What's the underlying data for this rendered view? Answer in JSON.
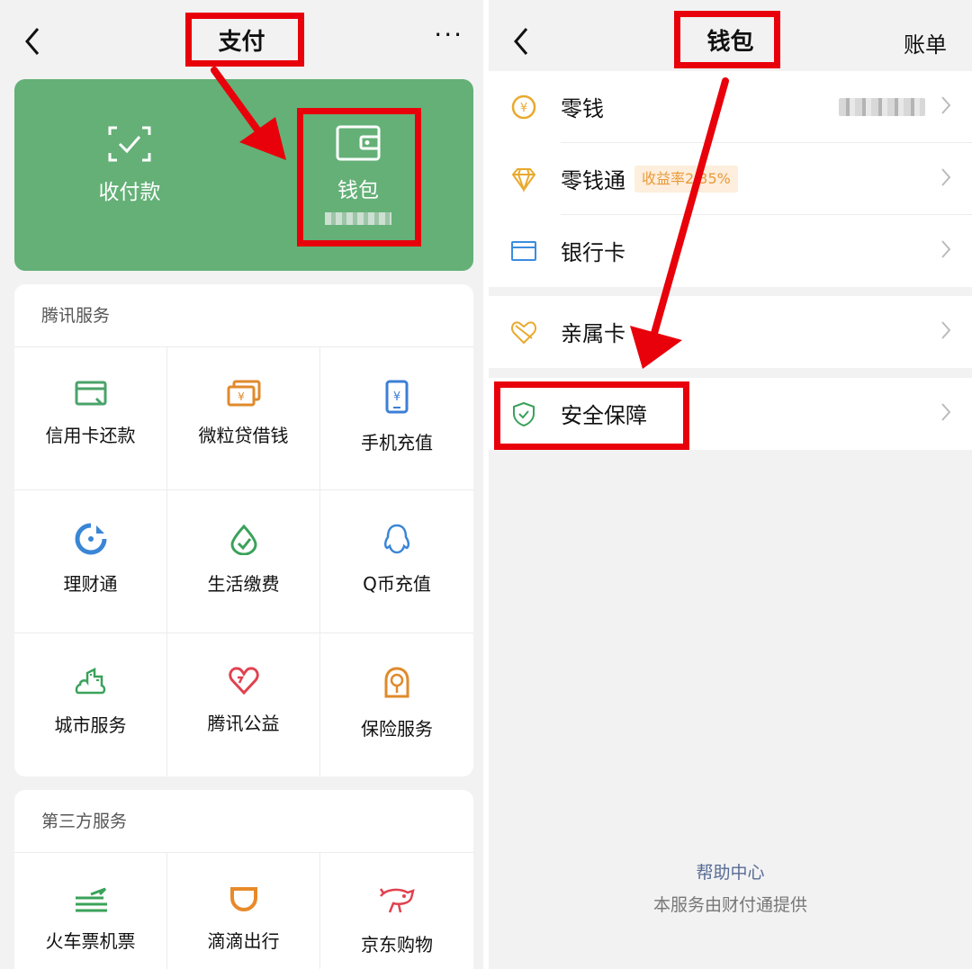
{
  "left": {
    "navbar": {
      "title": "支付",
      "more": "···"
    },
    "paycard": {
      "receive": {
        "label": "收付款",
        "icon": "scan-pay-icon"
      },
      "wallet": {
        "label": "钱包",
        "icon": "wallet-icon",
        "balance_hidden": true
      }
    },
    "tencent_services": {
      "title": "腾讯服务",
      "items": [
        {
          "label": "信用卡还款",
          "icon": "credit-card-icon"
        },
        {
          "label": "微粒贷借钱",
          "icon": "loan-icon"
        },
        {
          "label": "手机充值",
          "icon": "phone-recharge-icon"
        },
        {
          "label": "理财通",
          "icon": "wealth-icon"
        },
        {
          "label": "生活缴费",
          "icon": "bill-pay-icon"
        },
        {
          "label": "Q币充值",
          "icon": "qq-coin-icon"
        },
        {
          "label": "城市服务",
          "icon": "city-service-icon"
        },
        {
          "label": "腾讯公益",
          "icon": "charity-icon"
        },
        {
          "label": "保险服务",
          "icon": "insurance-icon"
        }
      ]
    },
    "third_party_services": {
      "title": "第三方服务",
      "items": [
        {
          "label": "火车票机票",
          "icon": "train-flight-icon"
        },
        {
          "label": "滴滴出行",
          "icon": "didi-icon"
        },
        {
          "label": "京东购物",
          "icon": "jd-shopping-icon"
        }
      ]
    }
  },
  "right": {
    "navbar": {
      "title": "钱包",
      "right_text": "账单"
    },
    "list": [
      {
        "label": "零钱",
        "icon": "coin-yuan-icon",
        "value_hidden": true
      },
      {
        "label": "零钱通",
        "icon": "diamond-icon",
        "badge": "收益率2.35%"
      },
      {
        "label": "银行卡",
        "icon": "bank-card-icon"
      },
      {
        "label": "亲属卡",
        "icon": "family-card-icon"
      },
      {
        "label": "安全保障",
        "icon": "shield-icon"
      }
    ],
    "footer": {
      "help": "帮助中心",
      "provider": "本服务由财付通提供"
    }
  },
  "colors": {
    "accent_green": "#64b077",
    "annotation_red": "#e8000b",
    "link_blue": "#576b95",
    "badge_orange": "#e99b3a"
  }
}
